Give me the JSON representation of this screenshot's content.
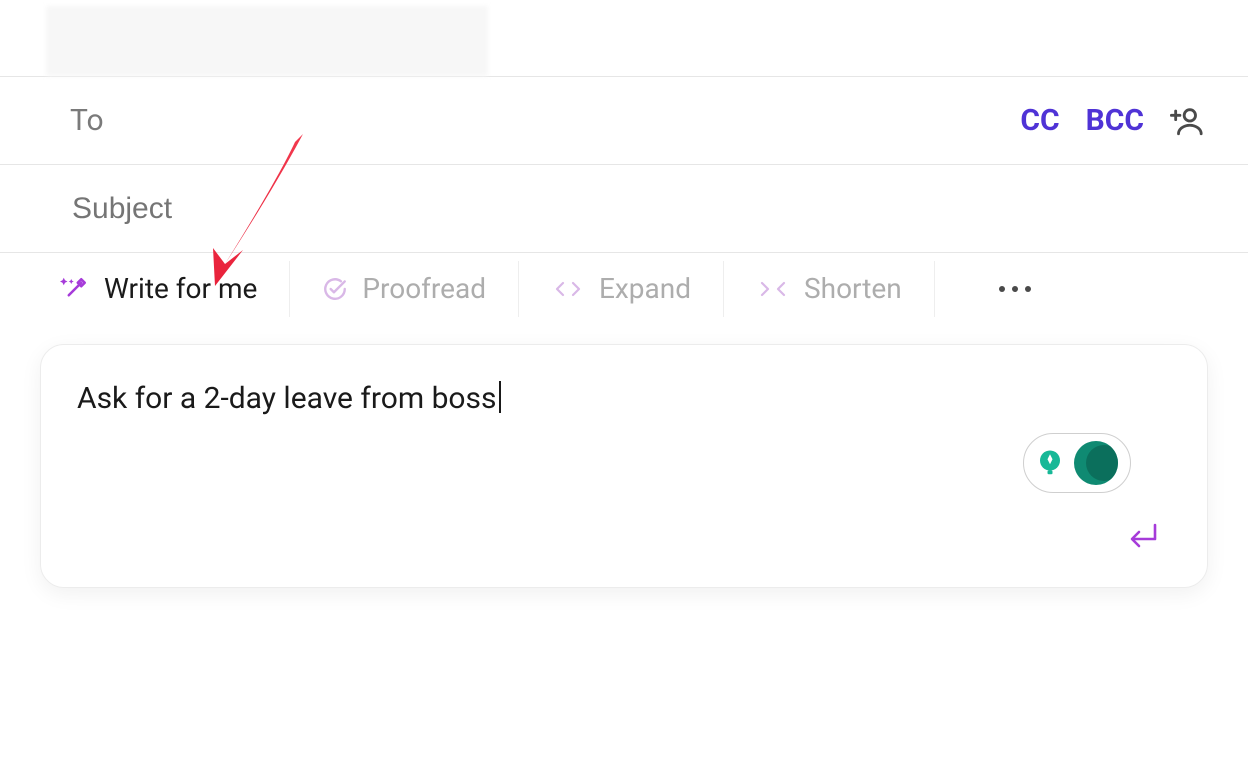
{
  "header": {},
  "to": {
    "label": "To",
    "value": "",
    "cc": "CC",
    "bcc": "BCC"
  },
  "subject": {
    "placeholder": "Subject",
    "value": ""
  },
  "toolbar": {
    "write_for_me": "Write for me",
    "proofread": "Proofread",
    "expand": "Expand",
    "shorten": "Shorten"
  },
  "compose": {
    "prompt": "Ask for a 2-day leave from boss"
  }
}
